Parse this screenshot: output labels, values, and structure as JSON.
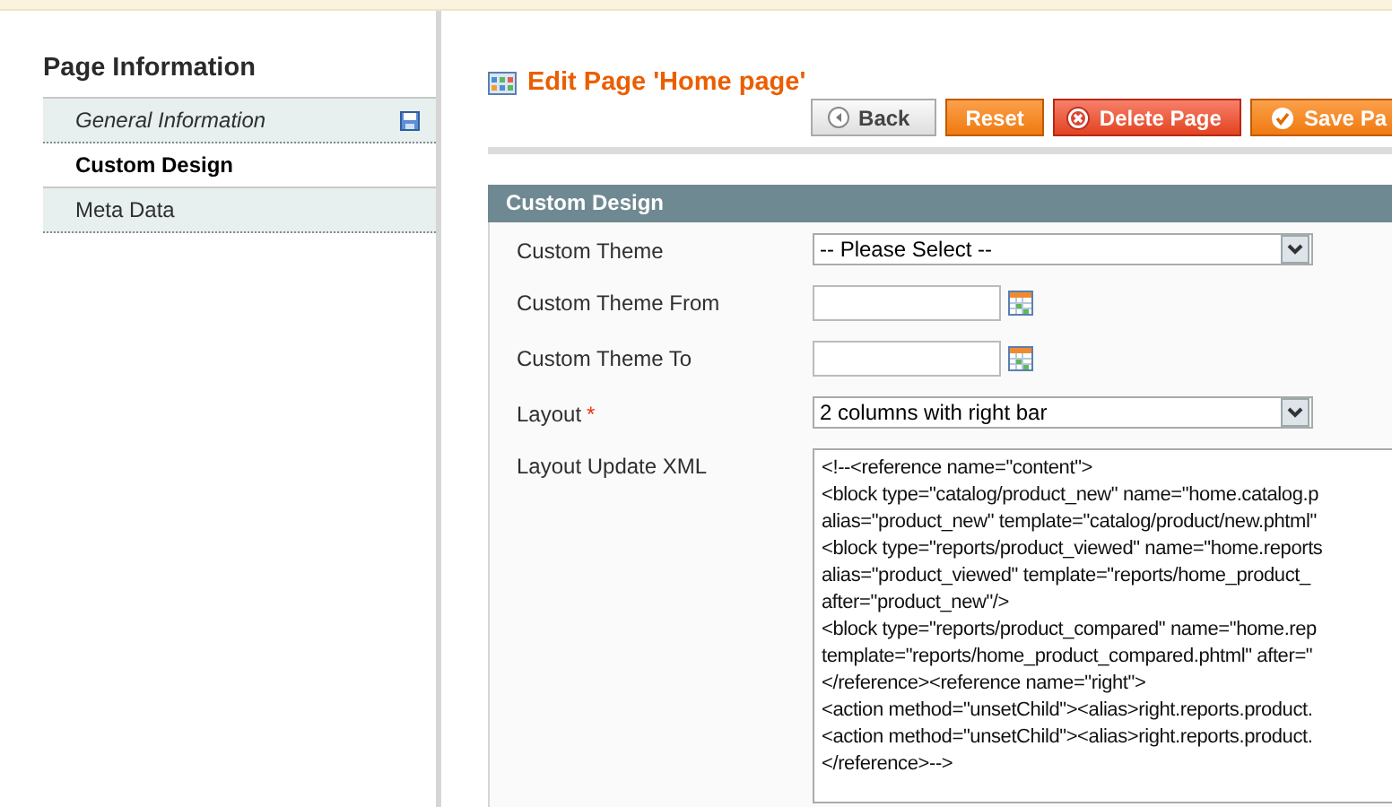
{
  "sidebar": {
    "title": "Page Information",
    "items": [
      {
        "label": "General Information",
        "selected": false,
        "changed": true
      },
      {
        "label": "Custom Design",
        "selected": true,
        "changed": false
      },
      {
        "label": "Meta Data",
        "selected": false,
        "changed": false
      }
    ]
  },
  "header": {
    "title": "Edit Page 'Home page'"
  },
  "buttons": [
    {
      "label": "Back",
      "kind": "back"
    },
    {
      "label": "Reset",
      "kind": "reset"
    },
    {
      "label": "Delete Page",
      "kind": "delete"
    },
    {
      "label": "Save Pa",
      "kind": "save"
    }
  ],
  "fieldset": {
    "title": "Custom Design",
    "fields": [
      {
        "label": "Custom Theme",
        "kind": "select",
        "value": "-- Please Select --"
      },
      {
        "label": "Custom Theme From",
        "kind": "date"
      },
      {
        "label": "Custom Theme To",
        "kind": "date"
      },
      {
        "label": "Layout",
        "kind": "select",
        "value": "2 columns with right bar",
        "required_mark": "*"
      },
      {
        "label": "Layout Update XML",
        "kind": "textarea",
        "lines": [
          "<!--<reference name=\"content\">",
          "<block type=\"catalog/product_new\" name=\"home.catalog.p",
          "alias=\"product_new\" template=\"catalog/product/new.phtml\"",
          "<block type=\"reports/product_viewed\" name=\"home.reports",
          "alias=\"product_viewed\" template=\"reports/home_product_",
          "after=\"product_new\"/>",
          "<block type=\"reports/product_compared\" name=\"home.rep",
          "template=\"reports/home_product_compared.phtml\" after=\"",
          "</reference><reference name=\"right\">",
          "<action method=\"unsetChild\"><alias>right.reports.product.",
          "<action method=\"unsetChild\"><alias>right.reports.product.",
          "</reference>-->"
        ]
      }
    ]
  }
}
